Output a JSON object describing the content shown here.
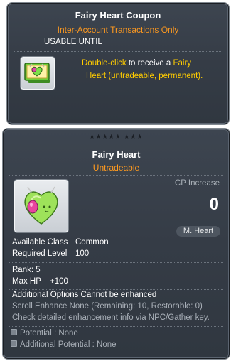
{
  "coupon": {
    "title": "Fairy Heart Coupon",
    "subtitle": "Inter-Account Transactions Only",
    "usable_until": "USABLE UNTIL",
    "desc_action": "Double-click",
    "desc_mid": " to receive a ",
    "desc_item": "Fairy",
    "desc_item2": "Heart",
    "desc_tail": " (untradeable, permanent).",
    "icon": "fairy-heart-coupon-icon"
  },
  "item": {
    "stars": "★★★★★  ★★★",
    "title": "Fairy Heart",
    "subtitle": "Untradeable",
    "cp_label": "CP Increase",
    "cp_value": "0",
    "type_badge": "M. Heart",
    "icon": "fairy-heart-icon",
    "available_class_label": "Available Class",
    "available_class_value": "Common",
    "required_level_label": "Required Level",
    "required_level_value": "100",
    "rank": "Rank: 5",
    "maxhp_label": "Max HP",
    "maxhp_value": "+100",
    "additional_options": "Additional Options Cannot be enhanced",
    "scroll_enhance": "Scroll Enhance None (Remaining: 10, Restorable: 0)",
    "check_info": "Check detailed enhancement info via NPC/Gather key.",
    "potential": "Potential : None",
    "additional_potential": "Additional Potential : None"
  },
  "colors": {
    "accent_orange": "#ff9a1f",
    "highlight_yellow": "#ffcc00",
    "panel_bg": "#353c46",
    "muted_text": "#a9b0b8"
  }
}
